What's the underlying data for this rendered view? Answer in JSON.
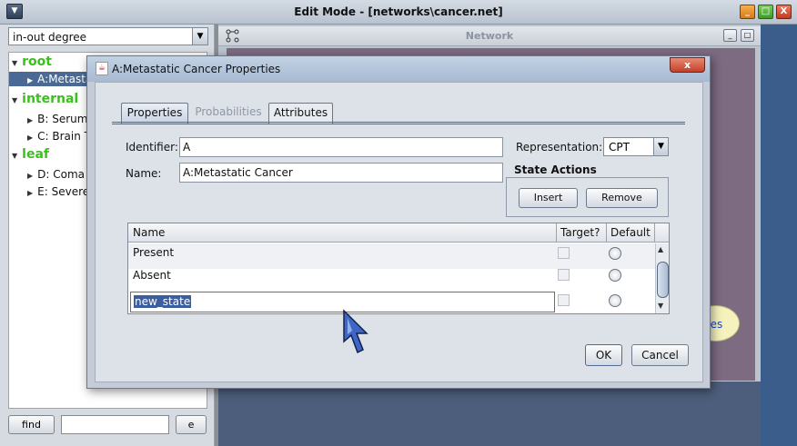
{
  "window": {
    "title": "Edit Mode - [networks\\cancer.net]",
    "menu_glyph": "▼",
    "min_glyph": "_",
    "max_glyph": "□",
    "close_glyph": "X"
  },
  "left": {
    "measure_select": "in-out degree",
    "tree": {
      "groups": [
        {
          "label": "root",
          "items": [
            "A:Metasta"
          ]
        },
        {
          "label": "internal",
          "items": [
            "B: Serum",
            "C:  Brain T"
          ]
        },
        {
          "label": "leaf",
          "items": [
            "D: Coma",
            "E: Severe"
          ]
        }
      ]
    },
    "find_label": "find",
    "e_label": "e"
  },
  "network": {
    "title": "Network",
    "bubble_text": "nes"
  },
  "dialog": {
    "title": "A:Metastatic Cancer Properties",
    "close_label": "x",
    "tabs": [
      "Properties",
      "Probabilities",
      "Attributes"
    ],
    "identifier_label": "Identifier:",
    "identifier_value": "A",
    "name_label": "Name:",
    "name_value": "A:Metastatic Cancer",
    "representation_label": "Representation:",
    "representation_value": "CPT",
    "state_actions_label": "State Actions",
    "insert_label": "Insert",
    "remove_label": "Remove",
    "table": {
      "columns": [
        "Name",
        "Target?",
        "Default"
      ],
      "rows": [
        "Present",
        "Absent",
        "new_state"
      ]
    },
    "ok_label": "OK",
    "cancel_label": "Cancel"
  }
}
